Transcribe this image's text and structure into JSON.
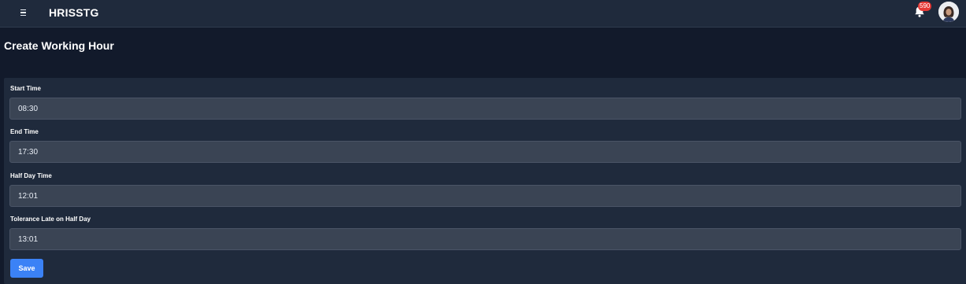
{
  "app": {
    "title": "HRISSTG"
  },
  "header": {
    "menu_icon": "hamburger-icon",
    "notification_icon": "bell-icon",
    "notification_count": "590",
    "avatar_icon": "user-avatar"
  },
  "page": {
    "title": "Create Working Hour"
  },
  "form": {
    "fields": [
      {
        "label": "Start Time",
        "value": "08:30"
      },
      {
        "label": "End Time",
        "value": "17:30"
      },
      {
        "label": "Half Day Time",
        "value": "12:01"
      },
      {
        "label": "Tolerance Late on Half Day",
        "value": "13:01"
      }
    ],
    "save_label": "Save"
  },
  "colors": {
    "background": "#121a2b",
    "topbar": "#1f2a3c",
    "panel": "#1f2a3c",
    "input": "#3a4454",
    "accent": "#3b82f6",
    "badge": "#e53935"
  }
}
